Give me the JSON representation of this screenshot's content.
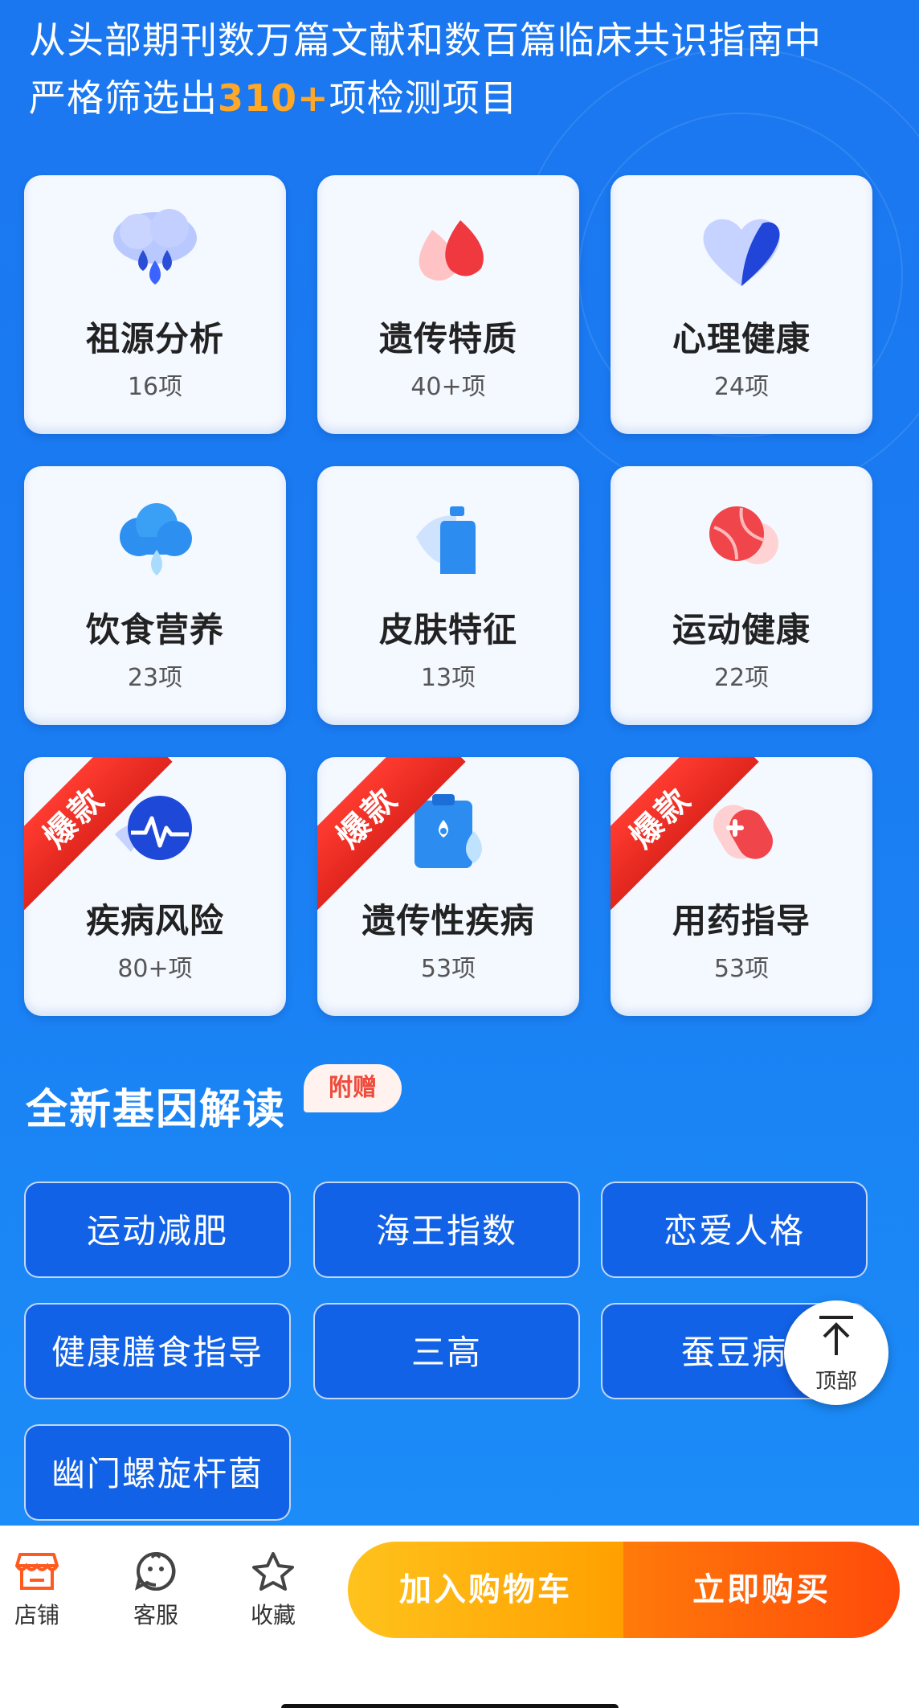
{
  "headline": {
    "line1": "从头部期刊数万篇文献和数百篇临床共识指南中",
    "line2_prefix": "严格筛选出",
    "line2_highlight": "310+",
    "line2_suffix": "项检测项目"
  },
  "categories": [
    {
      "title": "祖源分析",
      "count": "16项",
      "icon": "cloud-drop-icon"
    },
    {
      "title": "遗传特质",
      "count": "40+项",
      "icon": "blood-drop-icon"
    },
    {
      "title": "心理健康",
      "count": "24项",
      "icon": "heart-icon"
    },
    {
      "title": "饮食营养",
      "count": "23项",
      "icon": "nutrition-cloud-icon"
    },
    {
      "title": "皮肤特征",
      "count": "13项",
      "icon": "skincare-bottle-icon"
    },
    {
      "title": "运动健康",
      "count": "22项",
      "icon": "tennis-ball-icon"
    },
    {
      "title": "疾病风险",
      "count": "80+项",
      "icon": "pulse-heartbeat-icon",
      "badge": "爆款"
    },
    {
      "title": "遗传性疾病",
      "count": "53项",
      "icon": "clipboard-drop-icon",
      "badge": "爆款"
    },
    {
      "title": "用药指导",
      "count": "53项",
      "icon": "medicine-capsule-icon",
      "badge": "爆款"
    }
  ],
  "section": {
    "title": "全新基因解读",
    "badge": "附赠"
  },
  "tags": [
    "运动减肥",
    "海王指数",
    "恋爱人格",
    "健康膳食指导",
    "三高",
    "蚕豆病",
    "幽门螺旋杆菌"
  ],
  "back_to_top": {
    "label": "顶部",
    "icon": "arrow-up-icon"
  },
  "bottom_nav": [
    {
      "label": "店铺",
      "icon": "store-icon"
    },
    {
      "label": "客服",
      "icon": "customer-service-icon"
    },
    {
      "label": "收藏",
      "icon": "star-icon"
    }
  ],
  "actions": {
    "cart": "加入购物车",
    "buy": "立即购买"
  },
  "colors": {
    "hero_blue": "#1b77f0",
    "highlight": "#ffa726",
    "badge_red": "#e0261e",
    "cart_yellow": "#ffb300",
    "buy_orange": "#ff5a0a",
    "nav_icon_orange": "#ff5a1f"
  }
}
